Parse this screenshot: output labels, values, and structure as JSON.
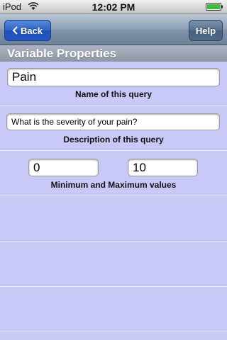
{
  "status_bar": {
    "carrier": "iPod",
    "time": "12:02 PM",
    "wifi_icon": "wifi-icon",
    "battery_icon": "battery-icon"
  },
  "nav": {
    "back_label": "Back",
    "help_label": "Help"
  },
  "section": {
    "title": "Variable Properties"
  },
  "form": {
    "name_value": "Pain",
    "name_caption": "Name of this query",
    "description_value": "What is the severity of your pain?",
    "description_caption": "Description of this query",
    "min_value": "0",
    "max_value": "10",
    "range_caption": "Minimum and Maximum values"
  },
  "colors": {
    "background": "#c9c9f7",
    "back_button": "#2b63c6",
    "nav_bar": "#8ea0b5"
  }
}
